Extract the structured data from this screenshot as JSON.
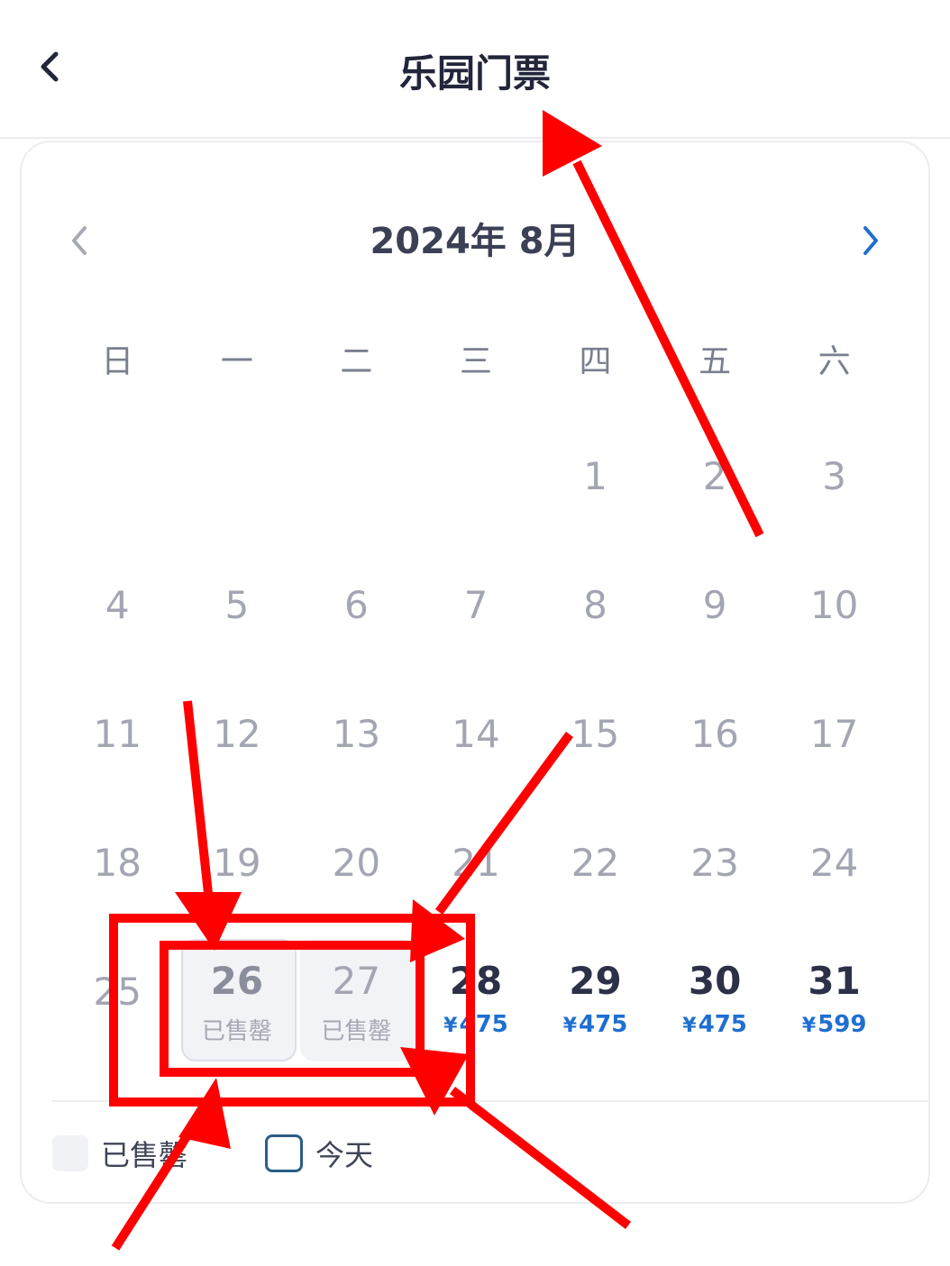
{
  "header": {
    "title": "乐园门票"
  },
  "calendar": {
    "month_label": "2024年 8月",
    "weekdays": [
      "日",
      "一",
      "二",
      "三",
      "四",
      "五",
      "六"
    ],
    "weeks": [
      [
        {
          "day": ""
        },
        {
          "day": ""
        },
        {
          "day": ""
        },
        {
          "day": ""
        },
        {
          "day": "1"
        },
        {
          "day": "2"
        },
        {
          "day": "3"
        }
      ],
      [
        {
          "day": "4"
        },
        {
          "day": "5"
        },
        {
          "day": "6"
        },
        {
          "day": "7"
        },
        {
          "day": "8"
        },
        {
          "day": "9"
        },
        {
          "day": "10"
        }
      ],
      [
        {
          "day": "11"
        },
        {
          "day": "12"
        },
        {
          "day": "13"
        },
        {
          "day": "14"
        },
        {
          "day": "15"
        },
        {
          "day": "16"
        },
        {
          "day": "17"
        }
      ],
      [
        {
          "day": "18"
        },
        {
          "day": "19"
        },
        {
          "day": "20"
        },
        {
          "day": "21"
        },
        {
          "day": "22"
        },
        {
          "day": "23"
        },
        {
          "day": "24"
        }
      ],
      [
        {
          "day": "25"
        },
        {
          "day": "26",
          "status": "已售罄",
          "today": true
        },
        {
          "day": "27",
          "status": "已售罄"
        },
        {
          "day": "28",
          "price": "475"
        },
        {
          "day": "29",
          "price": "475"
        },
        {
          "day": "30",
          "price": "475"
        },
        {
          "day": "31",
          "price": "599"
        }
      ]
    ],
    "currency_symbol": "¥"
  },
  "legend": {
    "sold_out_label": "已售罄",
    "today_label": "今天"
  },
  "colors": {
    "accent": "#1f6fd1",
    "annotation": "#ff0000"
  },
  "icons": {
    "back": "chevron-left-icon",
    "prev_month": "chevron-left-icon",
    "next_month": "chevron-right-icon"
  }
}
